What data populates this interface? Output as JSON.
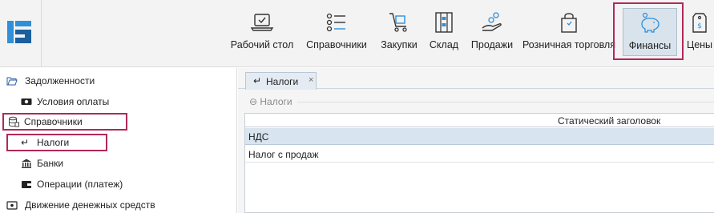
{
  "toolbar": {
    "items": [
      {
        "label": "Рабочий стол",
        "icon": "laptop-icon"
      },
      {
        "label": "Справочники",
        "icon": "list-icon"
      },
      {
        "label": "Закупки",
        "icon": "cart-icon"
      },
      {
        "label": "Склад",
        "icon": "warehouse-icon"
      },
      {
        "label": "Продажи",
        "icon": "hand-coins-icon"
      },
      {
        "label": "Розничная торговля",
        "icon": "shopping-bag-icon"
      },
      {
        "label": "Финансы",
        "icon": "piggy-bank-icon"
      },
      {
        "label": "Цены",
        "icon": "price-tag-icon"
      }
    ],
    "active": "Финансы"
  },
  "sidebar": {
    "items": [
      {
        "label": "Задолженности",
        "icon": "folder-open-icon"
      },
      {
        "label": "Условия оплаты",
        "icon": "cash-icon"
      },
      {
        "label": "Справочники",
        "icon": "database-icon"
      },
      {
        "label": "Налоги",
        "icon": "return-arrow-icon"
      },
      {
        "label": "Банки",
        "icon": "bank-icon"
      },
      {
        "label": "Операции (платеж)",
        "icon": "wallet-icon"
      },
      {
        "label": "Движение денежных средств",
        "icon": "money-flow-icon"
      }
    ]
  },
  "main": {
    "tab": {
      "label": "Налоги",
      "close": "×"
    },
    "group_header": "⊖ Налоги",
    "grid": {
      "column_header": "Статический заголовок",
      "rows": [
        "НДС",
        "Налог с продаж"
      ],
      "selected_row": 0
    }
  },
  "colors": {
    "highlight": "#b0285a",
    "active_bg": "#d9e3ec",
    "selected_row": "#d8e4ef",
    "toolbar_bg": "#f3f3f3"
  }
}
